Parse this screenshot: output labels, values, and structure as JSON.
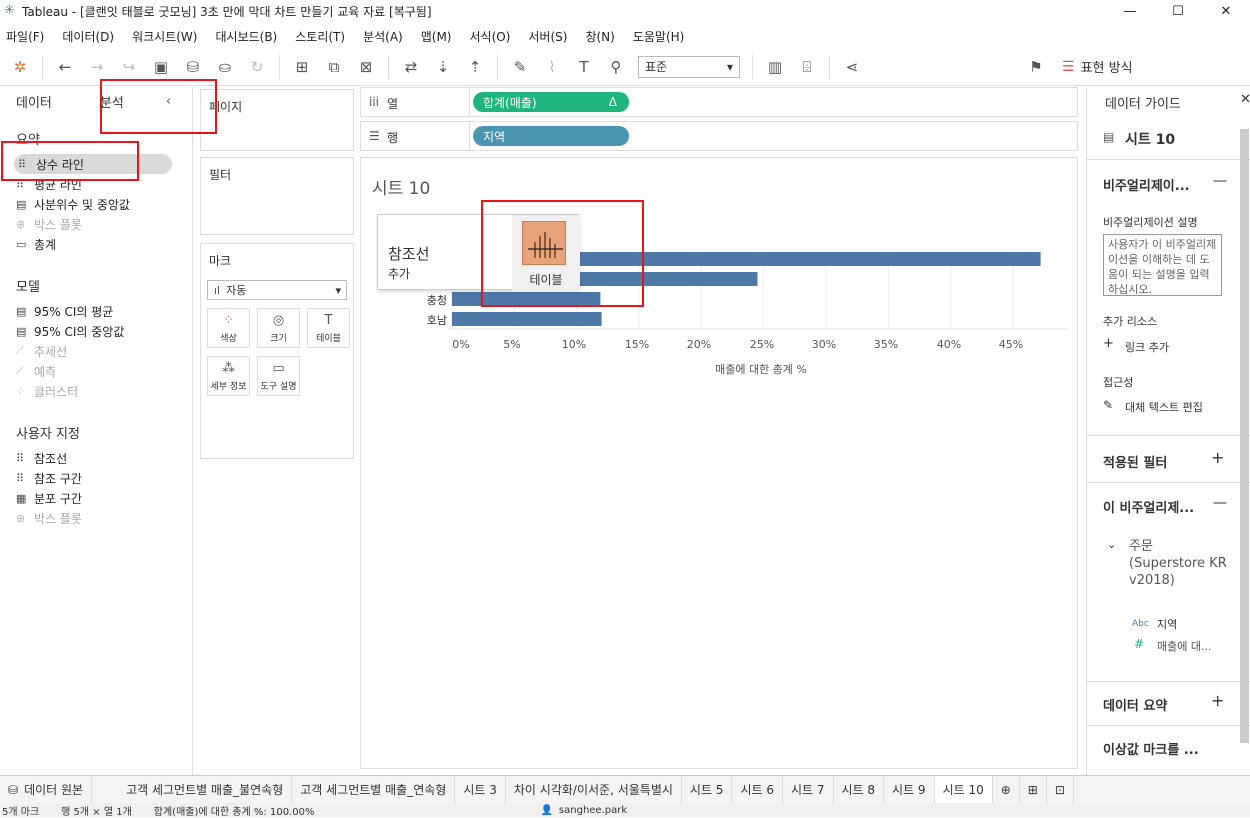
{
  "window": {
    "title": "Tableau - [클랜잇 태블로 굿모닝] 3초 만에 막대 차트 만들기 교육 자료 [복구됨]"
  },
  "menu": [
    "파일(F)",
    "데이터(D)",
    "워크시트(W)",
    "대시보드(B)",
    "스토리(T)",
    "분석(A)",
    "맵(M)",
    "서식(O)",
    "서버(S)",
    "창(N)",
    "도움말(H)"
  ],
  "toolbar": {
    "fit_select": "표준",
    "show_me_label": "표현 방식"
  },
  "left_panel": {
    "tab_data": "데이터",
    "tab_analysis": "분석",
    "summary_header": "요약",
    "summary_items": [
      {
        "label": "상수 라인",
        "icon": "constant-line-icon",
        "enabled": true,
        "selected": true
      },
      {
        "label": "평균 라인",
        "icon": "average-line-icon",
        "enabled": true
      },
      {
        "label": "사분위수 및 중앙값",
        "icon": "quartile-icon",
        "enabled": true
      },
      {
        "label": "박스 플롯",
        "icon": "box-plot-icon",
        "enabled": false
      },
      {
        "label": "총계",
        "icon": "totals-icon",
        "enabled": true
      }
    ],
    "model_header": "모델",
    "model_items": [
      {
        "label": "95% CI의 평균",
        "icon": "ci-mean-icon",
        "enabled": true
      },
      {
        "label": "95% CI의 중앙값",
        "icon": "ci-median-icon",
        "enabled": true
      },
      {
        "label": "추세선",
        "icon": "trend-line-icon",
        "enabled": false
      },
      {
        "label": "예측",
        "icon": "forecast-icon",
        "enabled": false
      },
      {
        "label": "클러스터",
        "icon": "cluster-icon",
        "enabled": false
      }
    ],
    "custom_header": "사용자 지정",
    "custom_items": [
      {
        "label": "참조선",
        "icon": "reference-line-icon",
        "enabled": true
      },
      {
        "label": "참조 구간",
        "icon": "reference-band-icon",
        "enabled": true
      },
      {
        "label": "분포 구간",
        "icon": "distribution-band-icon",
        "enabled": true
      },
      {
        "label": "박스 플롯",
        "icon": "box-plot-icon",
        "enabled": false
      }
    ]
  },
  "cards": {
    "pages": "페이지",
    "filters": "필터",
    "marks": "마크",
    "mark_type": "자동",
    "mark_buttons": [
      "색상",
      "크기",
      "테이블",
      "세부 정보",
      "도구 설명"
    ]
  },
  "shelves": {
    "columns_label": "열",
    "rows_label": "행",
    "columns_pill": "합계(매출)",
    "columns_pill_delta": "Δ",
    "rows_pill": "지역"
  },
  "sheet": {
    "title": "시트 10",
    "drop_popup": {
      "title": "참조선",
      "subtitle": "추가",
      "target": "테이블"
    }
  },
  "chart_data": {
    "type": "bar",
    "orientation": "horizontal",
    "categories_visible": [
      "충청",
      "호남"
    ],
    "values_pct": [
      47.2,
      24.5,
      11.9,
      12.0
    ],
    "x_ticks": [
      "0%",
      "5%",
      "10%",
      "15%",
      "20%",
      "25%",
      "30%",
      "35%",
      "40%",
      "45%"
    ],
    "xlim": [
      0,
      50
    ],
    "xlabel": "매출에 대한 총계 %",
    "bar_color": "#4e79a7"
  },
  "right_panel": {
    "header": "데이터 가이드",
    "sheet_name": "시트 10",
    "viz_section": "비주얼리제이...",
    "viz_desc_label": "비주얼리제이션 설명",
    "viz_desc_placeholder": "사용자가 이 비주얼리제이션을 이해하는 데 도움이 되는 설명을 입력하십시오.",
    "resources_label": "추가 리소스",
    "add_link": "링크 추가",
    "accessibility_label": "접근성",
    "alt_text_edit": "대체 텍스트 편집",
    "applied_filters": "적용된 필터",
    "this_viz": "이 비주얼리제...",
    "datasource": "주문 (Superstore KR v2018)",
    "fields": [
      {
        "type": "Abc",
        "name": "지역"
      },
      {
        "type": "#",
        "name": "매출에 대..."
      }
    ],
    "data_summary": "데이터 요약",
    "outliers": "이상값 마크를 ..."
  },
  "sheet_tabs": [
    "데이터 원본",
    "고객 세그먼트별 매출_불연속형",
    "고객 세그먼트별 매출_연속형",
    "시트 3",
    "차이 시각화/이서준, 서울특별시",
    "시트 5",
    "시트 6",
    "시트 7",
    "시트 8",
    "시트 9",
    "시트 10"
  ],
  "status": {
    "marks": "5개 마크",
    "rows_cols": "행 5개 × 열 1개",
    "sum": "합계(매출)에 대한 총계 %: 100.00%",
    "user": "sanghee.park"
  },
  "colors": {
    "accent_green": "#1fb57d",
    "accent_blue": "#4a95b0",
    "highlight_red": "#e8151b",
    "popup_icon_bg": "#e8a27c"
  }
}
